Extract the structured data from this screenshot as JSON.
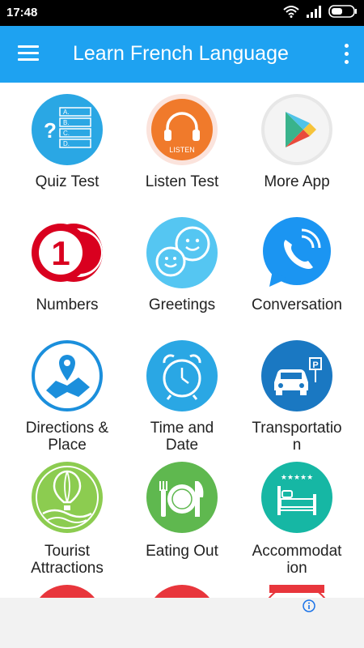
{
  "status_bar": {
    "time": "17:48"
  },
  "app_bar": {
    "title": "Learn French Language"
  },
  "grid": {
    "items": [
      {
        "label_line1": "Quiz Test",
        "label_line2": "",
        "icon": "quiz-icon"
      },
      {
        "label_line1": "Listen Test",
        "label_line2": "",
        "icon": "headphones-icon"
      },
      {
        "label_line1": "More App",
        "label_line2": "",
        "icon": "play-store-icon"
      },
      {
        "label_line1": "Numbers",
        "label_line2": "",
        "icon": "number-one-icon"
      },
      {
        "label_line1": "Greetings",
        "label_line2": "",
        "icon": "smiley-chat-icon"
      },
      {
        "label_line1": "Conversation",
        "label_line2": "",
        "icon": "phone-chat-icon"
      },
      {
        "label_line1": "Directions &",
        "label_line2": "Place",
        "icon": "map-pin-icon"
      },
      {
        "label_line1": "Time and",
        "label_line2": "Date",
        "icon": "alarm-clock-icon"
      },
      {
        "label_line1": "Transportatio",
        "label_line2": "n",
        "icon": "car-parking-icon"
      },
      {
        "label_line1": "Tourist",
        "label_line2": "Attractions",
        "icon": "hot-air-balloon-icon"
      },
      {
        "label_line1": "Eating Out",
        "label_line2": "",
        "icon": "plate-cutlery-icon"
      },
      {
        "label_line1": "Accommodat",
        "label_line2": "ion",
        "icon": "hotel-bed-icon"
      }
    ],
    "listen_badge": "LISTEN",
    "quiz_options": [
      "A.",
      "B.",
      "C.",
      "D."
    ],
    "quiz_marks": "?",
    "number_digit": "1",
    "parking_letter": "P"
  },
  "colors": {
    "app_bar": "#1ea2f1",
    "quiz": "#2aa7e4",
    "listen": "#f07a2b",
    "numbers": "#d9001f",
    "greetings": "#55c6f2",
    "conversation": "#1b95f2",
    "directions": "#1b8fdc",
    "time": "#2aa7e4",
    "transport": "#1a78c2",
    "tourist": "#8ccc50",
    "eating": "#5fb84f",
    "accommodation": "#16b7a4"
  }
}
